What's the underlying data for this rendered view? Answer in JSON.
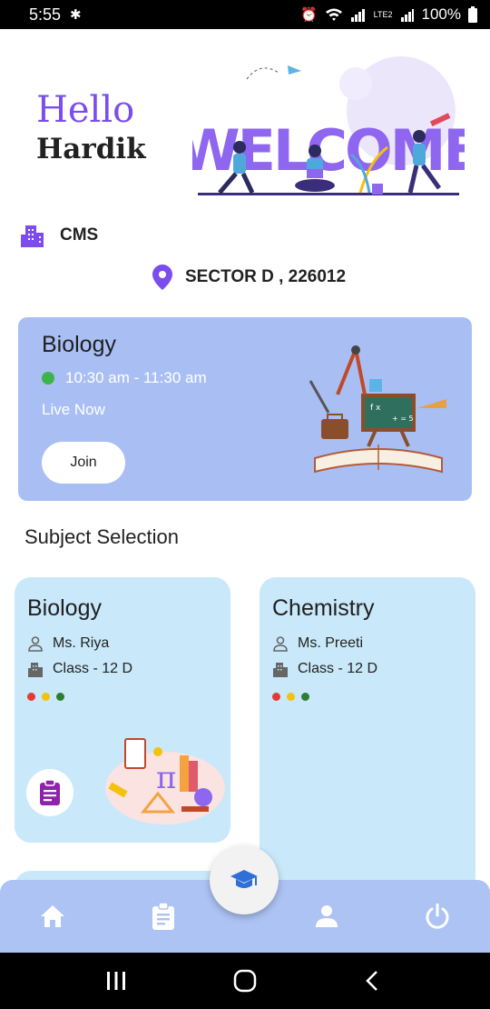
{
  "status_bar": {
    "time": "5:55",
    "battery": "100%",
    "network_label": "LTE2"
  },
  "greeting": {
    "hello": "Hello",
    "name": "Hardik"
  },
  "welcome_art": {
    "letters": "WELCOME",
    "accent_color": "#8e66ef"
  },
  "organization": {
    "name": "CMS",
    "icon": "building-icon"
  },
  "location": {
    "text": "SECTOR D , 226012",
    "icon": "location-pin-icon"
  },
  "live_class": {
    "subject": "Biology",
    "time": "10:30 am - 11:30 am",
    "status": "Live Now",
    "join_label": "Join",
    "card_color": "#a9bff4"
  },
  "subject_section": {
    "title": "Subject Selection"
  },
  "subjects": [
    {
      "name": "Biology",
      "teacher": "Ms. Riya",
      "class": "Class - 12 D",
      "dots": [
        "#e53935",
        "#f4c20d",
        "#2e7d32"
      ]
    },
    {
      "name": "Chemistry",
      "teacher": "Ms. Preeti",
      "class": "Class - 12 D",
      "dots": [
        "#e53935",
        "#f4c20d",
        "#2e7d32"
      ]
    }
  ],
  "bottom_nav": {
    "items": [
      "home-icon",
      "clipboard-icon",
      "graduation-cap-icon",
      "person-icon",
      "power-icon"
    ],
    "active": "graduation-cap-icon"
  },
  "colors": {
    "accent": "#7c4dec",
    "nav": "#adc3f3",
    "subject_card": "#c9e8f9",
    "fab_icon": "#2f6fd6"
  }
}
